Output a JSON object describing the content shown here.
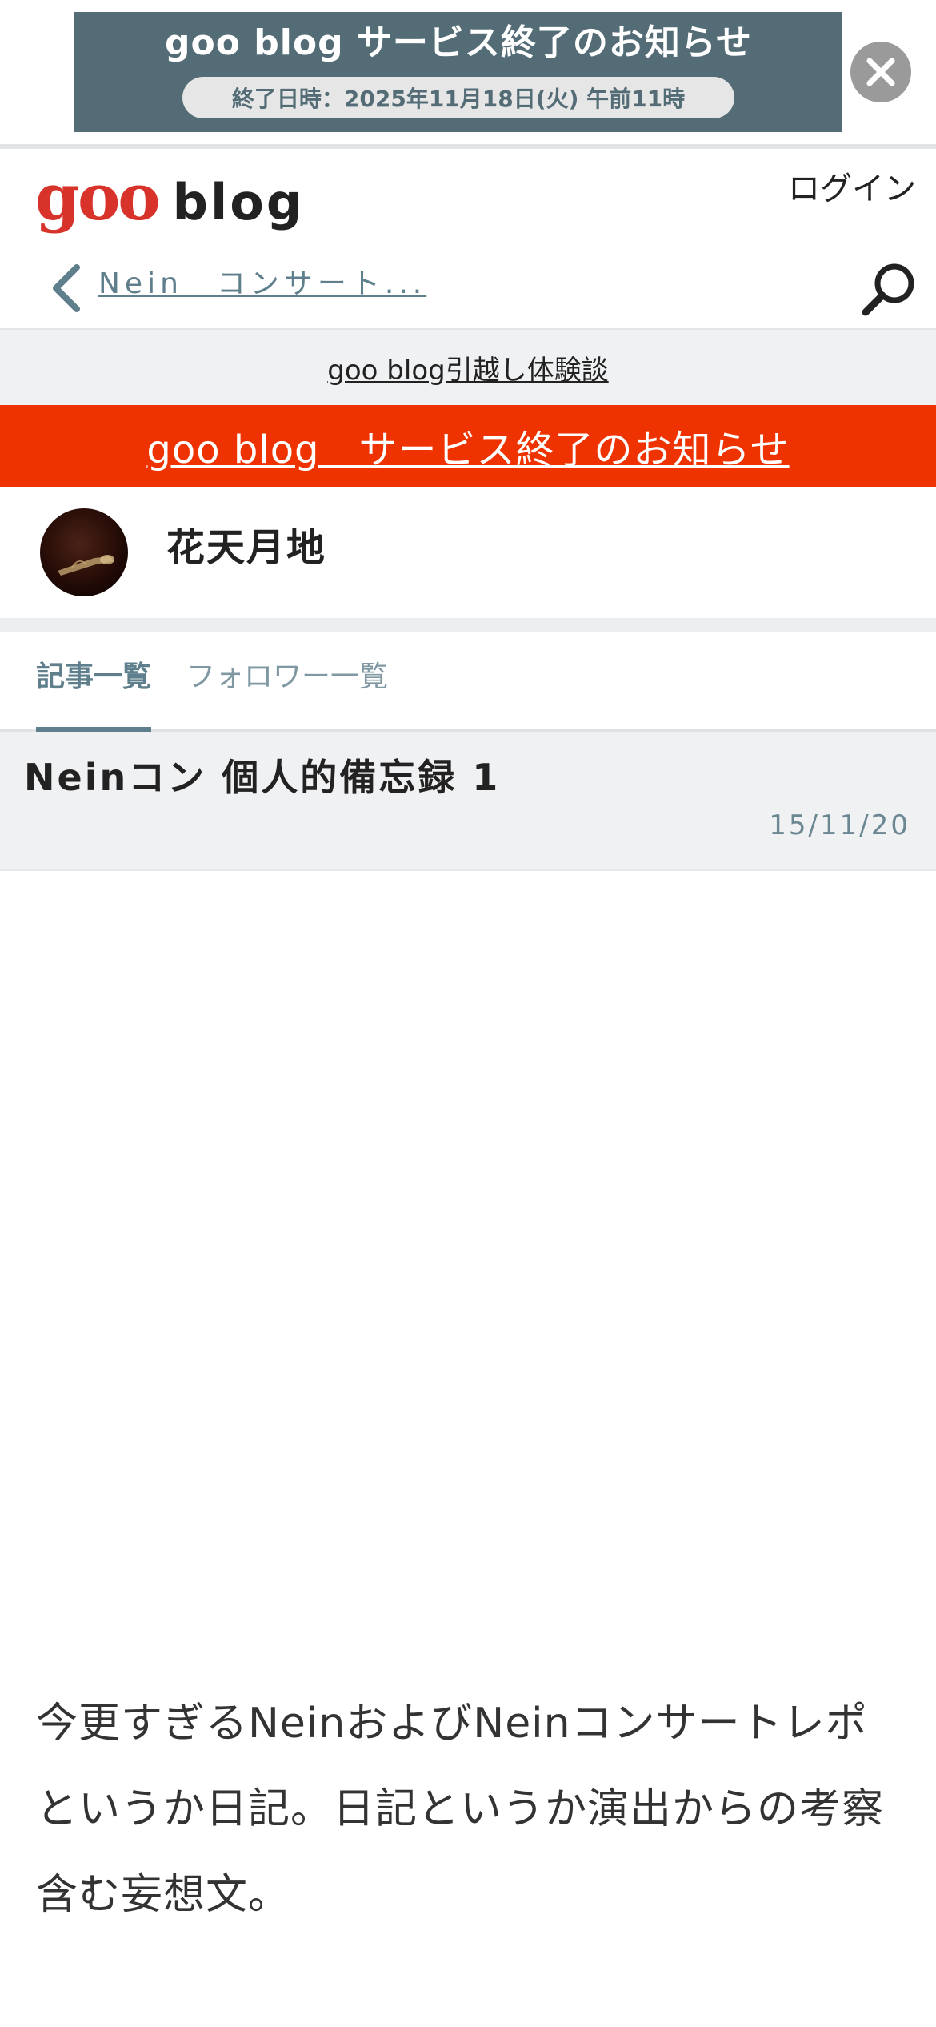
{
  "promo": {
    "title": "goo blog サービス終了のお知らせ",
    "subtitle": "終了日時：2025年11月18日(火) 午前11時",
    "close_icon": "close-icon"
  },
  "header": {
    "logo_goo": "goo",
    "logo_blog": "blog",
    "login": "ログイン"
  },
  "breadcrumb": {
    "back_icon": "chevron-left-icon",
    "text": "Nein　コンサート...",
    "search_icon": "search-icon"
  },
  "links": {
    "migration": "goo blog引越し体験談",
    "service_end": "goo blog　サービス終了のお知らせ"
  },
  "owner": {
    "name": "花天月地",
    "avatar": "avatar"
  },
  "tabs": [
    {
      "label": "記事一覧",
      "active": true
    },
    {
      "label": "フォロワー一覧",
      "active": false
    }
  ],
  "article": {
    "title": "Neinコン 個人的備忘録 1",
    "date": "15/11/20",
    "body": "今更すぎるNeinおよびNeinコンサートレポというか日記。日記というか演出からの考察含む妄想文。"
  },
  "colors": {
    "promo_bg": "#536c76",
    "accent": "#5f7f8c",
    "notice_red": "#ee3300",
    "logo_red": "#d8332a"
  }
}
